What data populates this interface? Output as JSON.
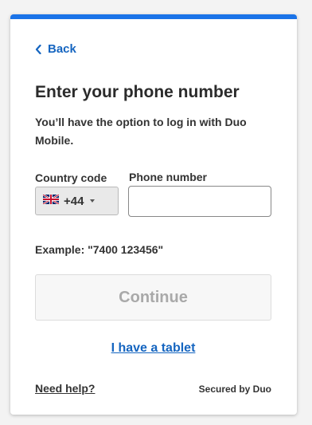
{
  "back": {
    "label": "Back"
  },
  "title": "Enter your phone number",
  "subtitle": "You’ll have the option to log in with Duo Mobile.",
  "country": {
    "label": "Country code",
    "selected_code": "+44",
    "flag": "uk-flag-icon"
  },
  "phone": {
    "label": "Phone number",
    "value": "",
    "placeholder": ""
  },
  "example": "Example: \"7400 123456\"",
  "continue_label": "Continue",
  "tablet_link": "I have a tablet",
  "help_link": "Need help?",
  "secured_by": "Secured by Duo",
  "colors": {
    "accent": "#1a73e8",
    "link": "#1565c0",
    "disabled_text": "#a9a9a9"
  }
}
